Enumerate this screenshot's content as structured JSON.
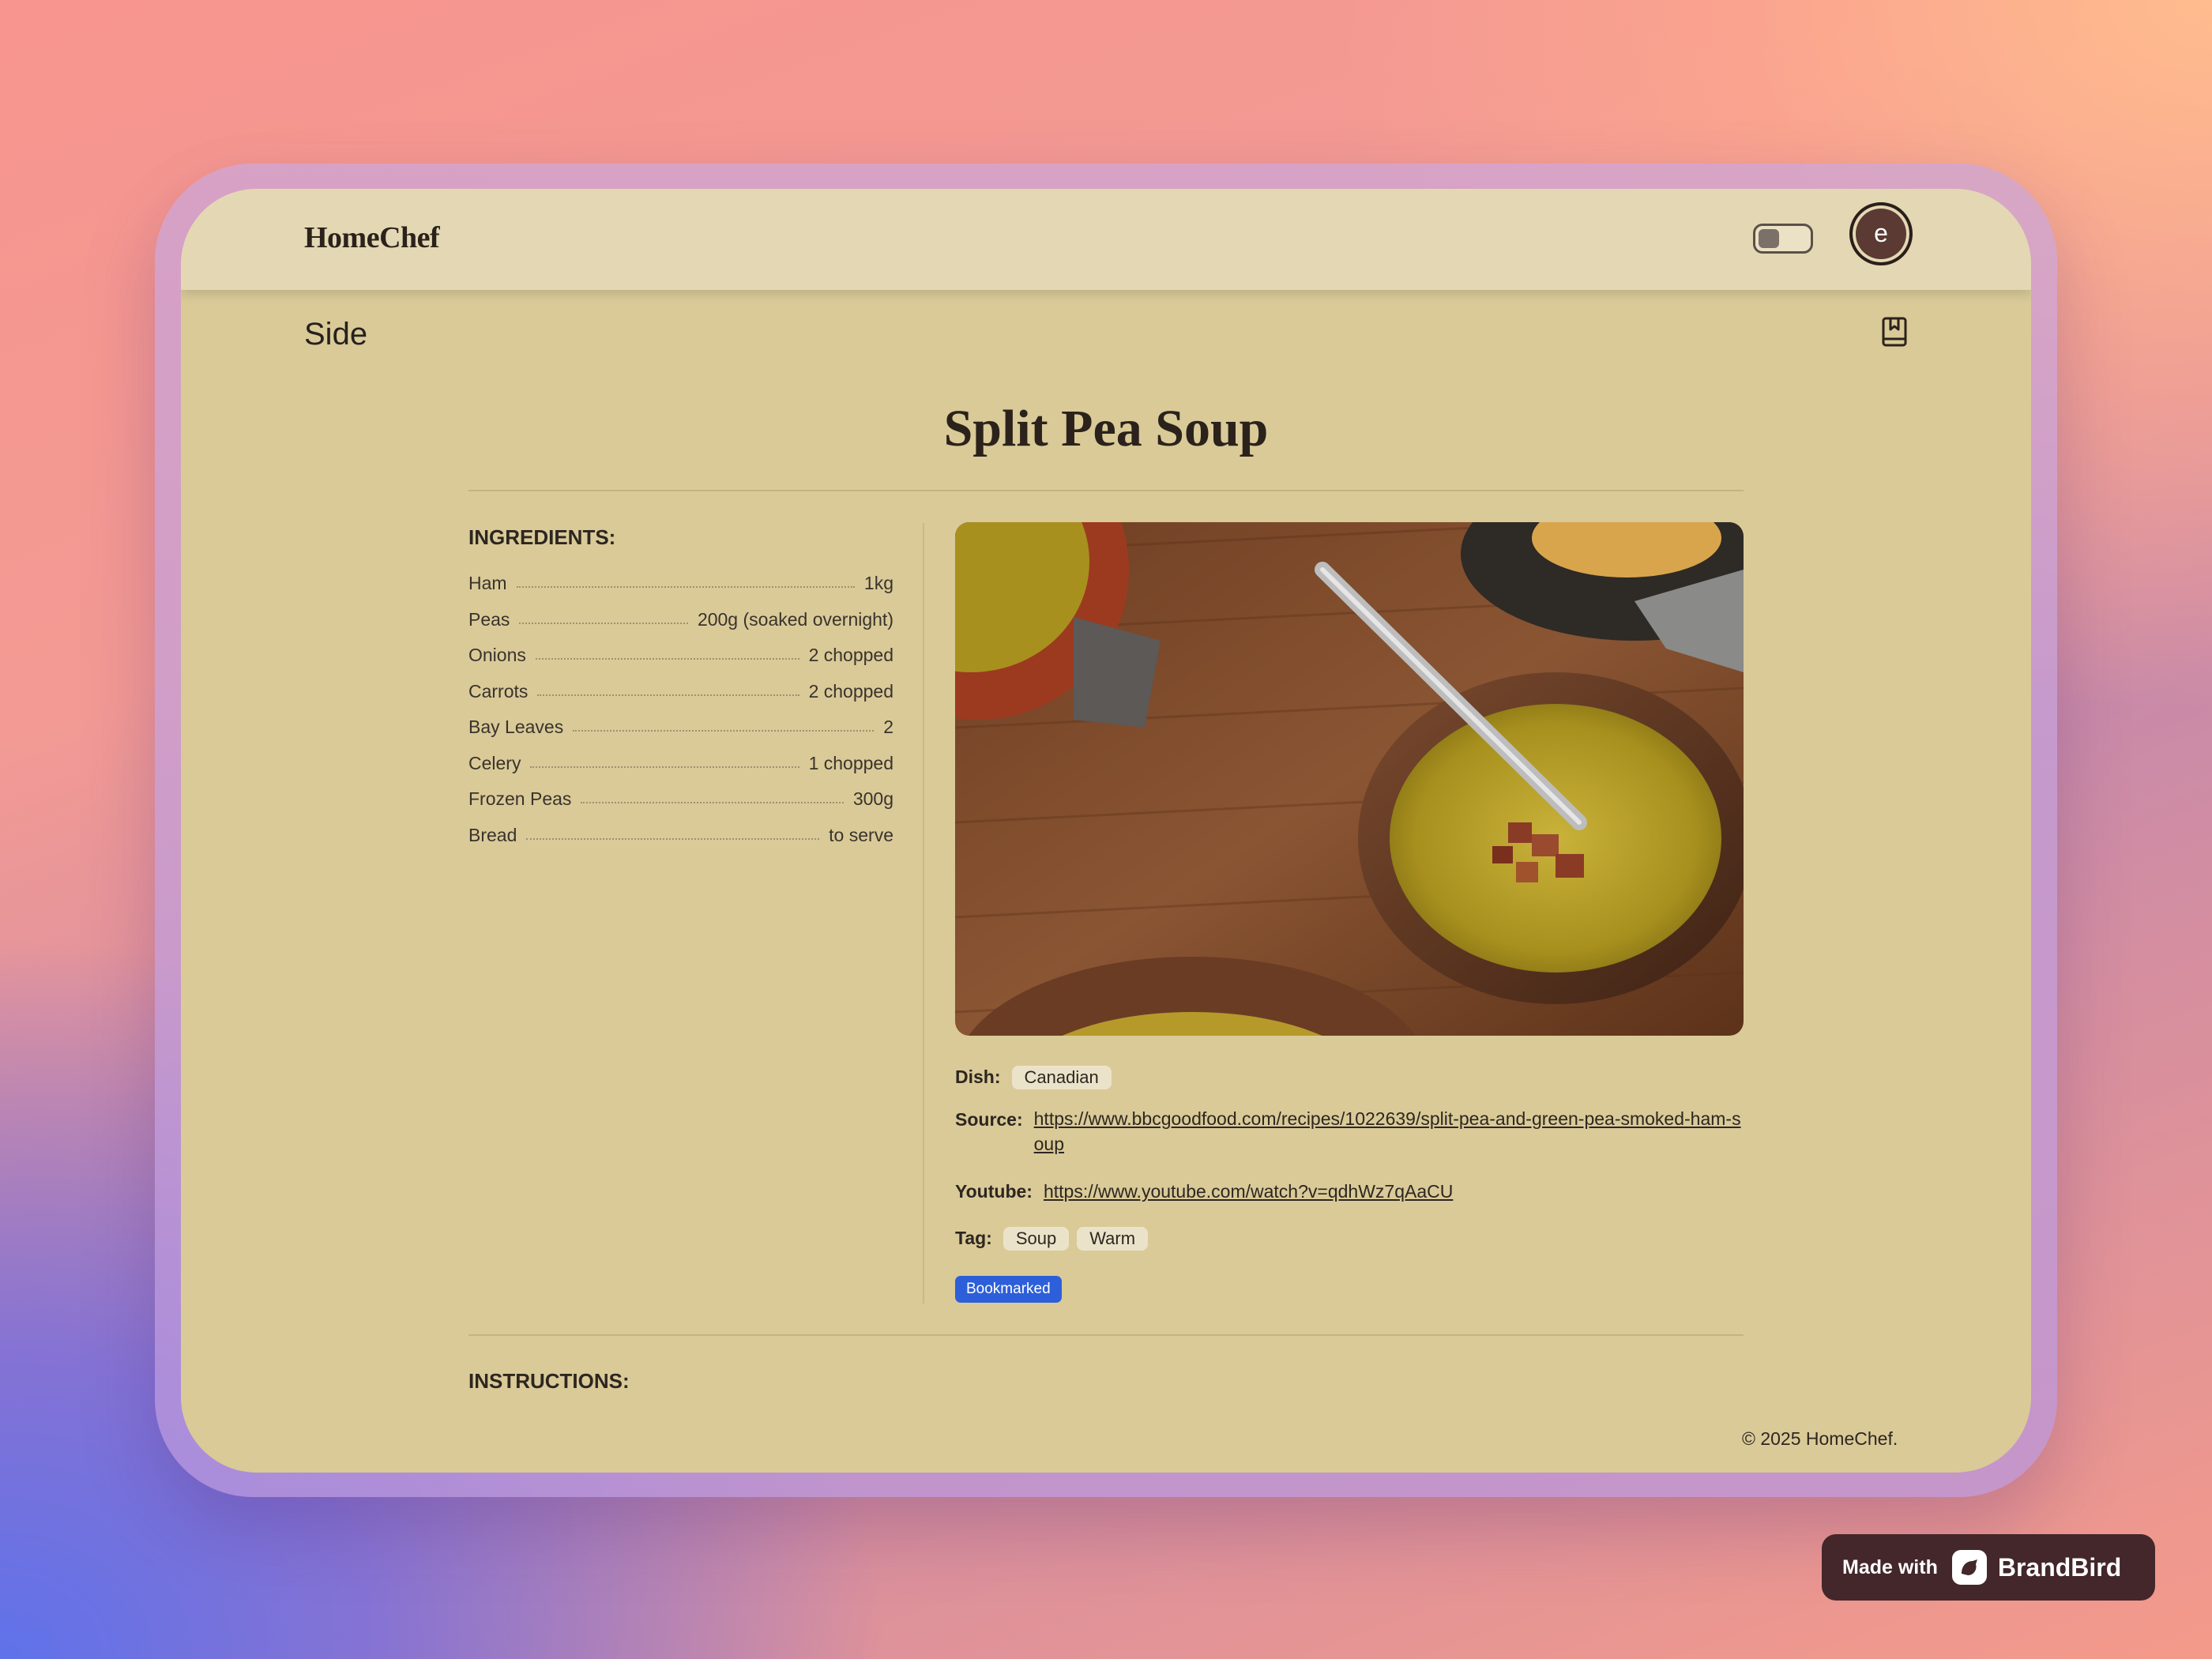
{
  "app": {
    "name": "HomeChef"
  },
  "header": {
    "avatar_letter": "e"
  },
  "page": {
    "category": "Side",
    "title": "Split Pea Soup"
  },
  "ingredients": {
    "heading": "INGREDIENTS:",
    "items": [
      {
        "name": "Ham",
        "qty": "1kg"
      },
      {
        "name": "Peas",
        "qty": "200g (soaked overnight)"
      },
      {
        "name": "Onions",
        "qty": "2 chopped"
      },
      {
        "name": "Carrots",
        "qty": "2 chopped"
      },
      {
        "name": "Bay Leaves",
        "qty": "2"
      },
      {
        "name": "Celery",
        "qty": "1 chopped"
      },
      {
        "name": "Frozen Peas",
        "qty": "300g"
      },
      {
        "name": "Bread",
        "qty": "to serve"
      }
    ]
  },
  "details": {
    "dish_label": "Dish:",
    "dish": "Canadian",
    "source_label": "Source:",
    "source_url": "https://www.bbcgoodfood.com/recipes/1022639/split-pea-and-green-pea-smoked-ham-soup",
    "youtube_label": "Youtube:",
    "youtube_url": "https://www.youtube.com/watch?v=qdhWz7qAaCU",
    "tag_label": "Tag:",
    "tags": [
      "Soup",
      "Warm"
    ],
    "bookmarked_badge": "Bookmarked"
  },
  "instructions": {
    "heading": "INSTRUCTIONS:"
  },
  "footer": {
    "copyright": "© 2025 HomeChef."
  },
  "watermark": {
    "made_with": "Made with",
    "brand": "BrandBird"
  },
  "icons": {
    "bookmark": "bookmark-icon",
    "theme_toggle": "theme-toggle",
    "brand_logo": "brandbird-logo-icon"
  },
  "colors": {
    "screen_bg": "#d9ca98",
    "topbar_bg": "#e3d8b3",
    "badge_blue": "#2c5fd9",
    "avatar": "#5a3a33"
  },
  "theme_toggle": {
    "on": false
  }
}
